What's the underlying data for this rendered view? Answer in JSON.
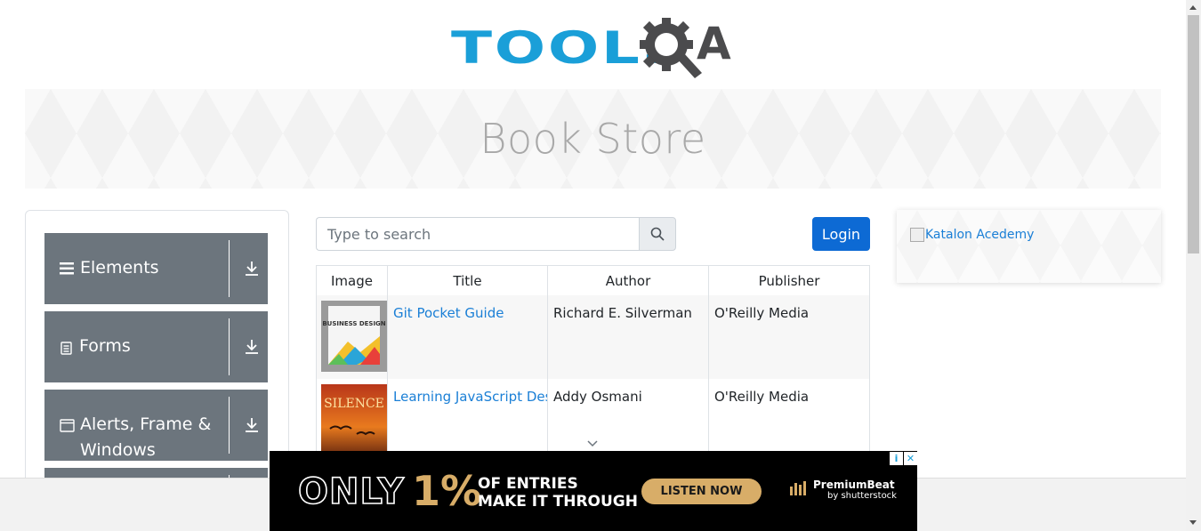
{
  "header": {
    "logo_tools": "TOOLS",
    "logo_qa": "A",
    "logo_alt": "TOOLSQA"
  },
  "banner": {
    "title": "Book Store"
  },
  "sidebar": {
    "groups": [
      {
        "label": "Elements",
        "icon": "menu-icon"
      },
      {
        "label": "Forms",
        "icon": "document-icon"
      },
      {
        "label": "Alerts, Frame & Windows",
        "icon": "window-icon"
      }
    ]
  },
  "search": {
    "placeholder": "Type to search",
    "value": ""
  },
  "login": {
    "label": "Login"
  },
  "table": {
    "columns": [
      "Image",
      "Title",
      "Author",
      "Publisher"
    ],
    "rows": [
      {
        "title": "Git Pocket Guide",
        "author": "Richard E. Silverman",
        "publisher": "O'Reilly Media",
        "cover_text": "BUSINESS DESIGN"
      },
      {
        "title": "Learning JavaScript Design Patterns",
        "author": "Addy Osmani",
        "publisher": "O'Reilly Media",
        "cover_text": "SILENCE"
      }
    ]
  },
  "right_ad": {
    "alt": "Katalon Acedemy"
  },
  "bottom_ad": {
    "only": "ONLY",
    "percent": "1%",
    "line1": "OF ENTRIES",
    "line2": "MAKE IT THROUGH",
    "cta": "LISTEN NOW",
    "brand": "PremiumBeat",
    "brand_sub": "by shutterstock"
  },
  "colors": {
    "brand_blue": "#1a9fd8",
    "accordion_grey": "#6c757d",
    "login_blue": "#0d6ad4",
    "ad_gold": "#d8ad68"
  }
}
